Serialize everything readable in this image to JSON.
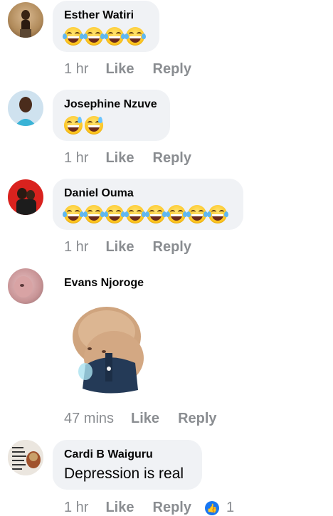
{
  "comments": [
    {
      "name": "Esther Watiri",
      "time": "1 hr",
      "like": "Like",
      "reply": "Reply",
      "emoji_count": 4,
      "emoji_icon": "joy-emoji-icon"
    },
    {
      "name": "Josephine Nzuve",
      "time": "1 hr",
      "like": "Like",
      "reply": "Reply",
      "emoji_count": 2,
      "emoji_icon": "sweat-smile-emoji-icon"
    },
    {
      "name": "Daniel Ouma",
      "time": "1 hr",
      "like": "Like",
      "reply": "Reply",
      "emoji_count": 8,
      "emoji_icon": "joy-emoji-icon"
    },
    {
      "name": "Evans Njoroge",
      "time": "47 mins",
      "like": "Like",
      "reply": "Reply",
      "sticker_icon": "crying-bear-sticker"
    },
    {
      "name": "Cardi B Waiguru",
      "text": "Depression is real",
      "time": "1 hr",
      "like": "Like",
      "reply": "Reply",
      "reaction_count": "1",
      "reaction_icon": "thumbs-up-icon"
    }
  ],
  "colors": {
    "bubble": "#f0f2f5",
    "meta": "#8a8d91",
    "like_blue": "#1877f2"
  }
}
